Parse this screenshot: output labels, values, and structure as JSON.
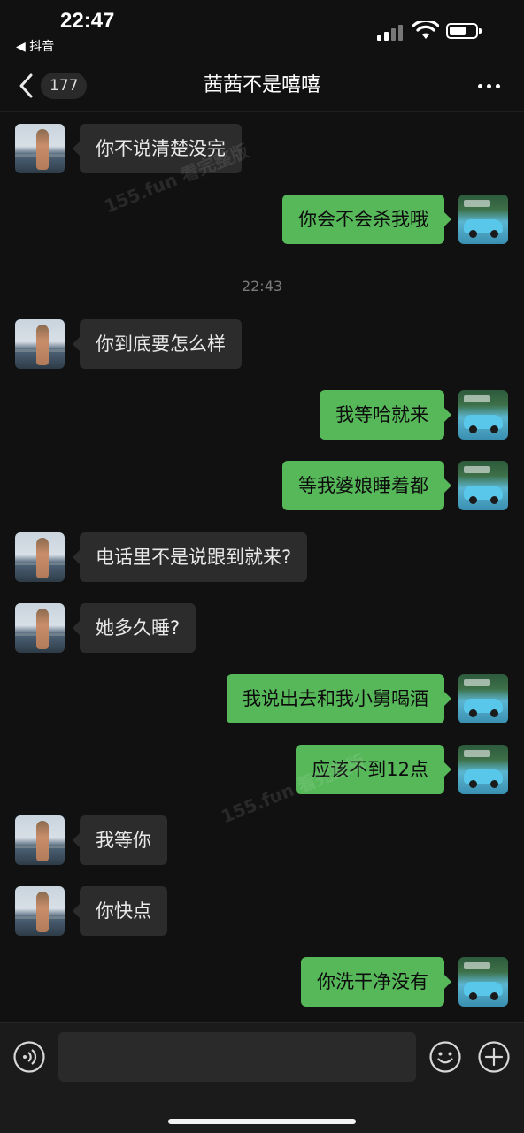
{
  "status_bar": {
    "time": "22:47",
    "back_app_label": "◀ 抖音"
  },
  "header": {
    "unread_count": "177",
    "title": "茜茜不是嘻嘻"
  },
  "watermark": "155.fun 看完整版",
  "timestamp": "22:43",
  "messages": [
    {
      "side": "in",
      "text": "你不说清楚没完"
    },
    {
      "side": "out",
      "text": "你会不会杀我哦"
    },
    {
      "side": "in",
      "text": "你到底要怎么样"
    },
    {
      "side": "out",
      "text": "我等哈就来"
    },
    {
      "side": "out",
      "text": "等我婆娘睡着都"
    },
    {
      "side": "in",
      "text": "电话里不是说跟到就来?"
    },
    {
      "side": "in",
      "text": "她多久睡?"
    },
    {
      "side": "out",
      "text": "我说出去和我小舅喝酒"
    },
    {
      "side": "out",
      "text": "应该不到12点"
    },
    {
      "side": "in",
      "text": "我等你"
    },
    {
      "side": "in",
      "text": "你快点"
    },
    {
      "side": "out",
      "text": "你洗干净没有"
    }
  ],
  "colors": {
    "background": "#111111",
    "incoming_bubble": "#2c2c2c",
    "outgoing_bubble": "#57b85a"
  },
  "icons": {
    "back": "chevron-left-icon",
    "more": "more-dots-icon",
    "voice": "voice-icon",
    "emoji": "emoji-icon",
    "plus": "plus-icon"
  }
}
